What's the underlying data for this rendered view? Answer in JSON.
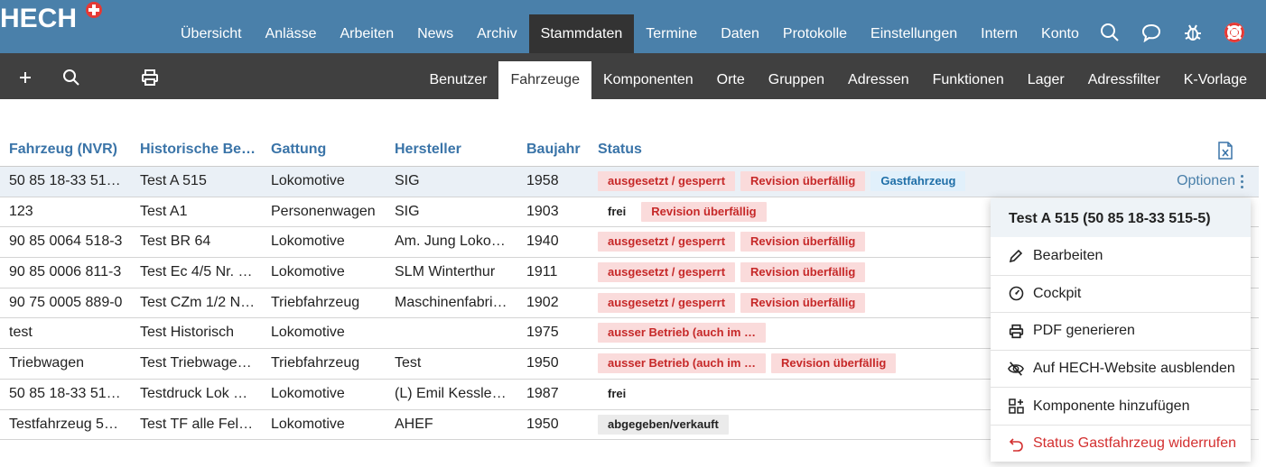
{
  "brand": {
    "name": "HECH"
  },
  "main_nav": [
    {
      "label": "Übersicht"
    },
    {
      "label": "Anlässe"
    },
    {
      "label": "Arbeiten"
    },
    {
      "label": "News"
    },
    {
      "label": "Archiv"
    },
    {
      "label": "Stammdaten",
      "active": true
    },
    {
      "label": "Termine"
    },
    {
      "label": "Daten"
    },
    {
      "label": "Protokolle"
    },
    {
      "label": "Einstellungen"
    },
    {
      "label": "Intern"
    },
    {
      "label": "Konto"
    }
  ],
  "top_icons": [
    "search-icon",
    "chat-bubble-icon",
    "bug-icon",
    "lifebuoy-icon"
  ],
  "toolbar_icons": [
    "plus-icon",
    "search-icon",
    "print-icon"
  ],
  "sub_nav": [
    {
      "label": "Benutzer"
    },
    {
      "label": "Fahrzeuge",
      "active": true
    },
    {
      "label": "Komponenten"
    },
    {
      "label": "Orte"
    },
    {
      "label": "Gruppen"
    },
    {
      "label": "Adressen"
    },
    {
      "label": "Funktionen"
    },
    {
      "label": "Lager"
    },
    {
      "label": "Adressfilter"
    },
    {
      "label": "K-Vorlage"
    }
  ],
  "table": {
    "columns": [
      "Fahrzeug (NVR)",
      "Historische Be…",
      "Gattung",
      "Hersteller",
      "Baujahr",
      "Status"
    ],
    "export_icon": "excel-export-icon",
    "options_label": "Optionen",
    "rows": [
      {
        "nvr": "50 85 18-33 51…",
        "hist": "Test A 515",
        "gattung": "Lokomotive",
        "hersteller": "SIG",
        "baujahr": "1958",
        "status": [
          {
            "text": "ausgesetzt / gesperrt",
            "style": "red"
          },
          {
            "text": "Revision überfällig",
            "style": "red"
          },
          {
            "text": "Gastfahrzeug",
            "style": "blue"
          }
        ],
        "selected": true
      },
      {
        "nvr": "123",
        "hist": "Test A1",
        "gattung": "Personenwagen",
        "hersteller": "SIG",
        "baujahr": "1903",
        "status": [
          {
            "text": "frei",
            "style": "plain"
          },
          {
            "text": "Revision überfällig",
            "style": "red"
          }
        ]
      },
      {
        "nvr": "90 85 0064 518-3",
        "hist": "Test BR 64",
        "gattung": "Lokomotive",
        "hersteller": "Am. Jung Loko…",
        "baujahr": "1940",
        "status": [
          {
            "text": "ausgesetzt / gesperrt",
            "style": "red"
          },
          {
            "text": "Revision überfällig",
            "style": "red"
          }
        ]
      },
      {
        "nvr": "90 85 0006 811-3",
        "hist": "Test Ec 4/5 Nr. …",
        "gattung": "Lokomotive",
        "hersteller": "SLM Winterthur",
        "baujahr": "1911",
        "status": [
          {
            "text": "ausgesetzt / gesperrt",
            "style": "red"
          },
          {
            "text": "Revision überfällig",
            "style": "red"
          }
        ]
      },
      {
        "nvr": "90 75 0005 889-0",
        "hist": "Test CZm 1/2 N…",
        "gattung": "Triebfahrzeug",
        "hersteller": "Maschinenfabri…",
        "baujahr": "1902",
        "status": [
          {
            "text": "ausgesetzt / gesperrt",
            "style": "red"
          },
          {
            "text": "Revision überfällig",
            "style": "red"
          }
        ]
      },
      {
        "nvr": "test",
        "hist": "Test Historisch",
        "gattung": "Lokomotive",
        "hersteller": "",
        "baujahr": "1975",
        "status": [
          {
            "text": "ausser Betrieb (auch im …",
            "style": "red"
          }
        ]
      },
      {
        "nvr": "Triebwagen",
        "hist": "Test Triebwage…",
        "gattung": "Triebfahrzeug",
        "hersteller": "Test",
        "baujahr": "1950",
        "status": [
          {
            "text": "ausser Betrieb (auch im …",
            "style": "red"
          },
          {
            "text": "Revision überfällig",
            "style": "red"
          }
        ]
      },
      {
        "nvr": "50 85 18-33 51…",
        "hist": "Testdruck Lok 5…",
        "gattung": "Lokomotive",
        "hersteller": "(L) Emil Kessler…",
        "baujahr": "1987",
        "status": [
          {
            "text": "frei",
            "style": "plain"
          }
        ]
      },
      {
        "nvr": "Testfahrzeug 5…",
        "hist": "Test TF alle Fel…",
        "gattung": "Lokomotive",
        "hersteller": "AHEF",
        "baujahr": "1950",
        "status": [
          {
            "text": "abgegeben/verkauft",
            "style": "grey"
          }
        ]
      }
    ]
  },
  "menu": {
    "title": "Test A 515 (50 85 18-33 515-5)",
    "items": [
      {
        "label": "Bearbeiten",
        "icon": "pencil-icon"
      },
      {
        "label": "Cockpit",
        "icon": "gauge-icon"
      },
      {
        "label": "PDF generieren",
        "icon": "print-icon"
      },
      {
        "label": "Auf HECH-Website ausblenden",
        "icon": "eye-off-icon"
      },
      {
        "label": "Komponente hinzufügen",
        "icon": "add-component-icon"
      },
      {
        "label": "Status Gastfahrzeug widerrufen",
        "icon": "undo-icon",
        "danger": true
      }
    ]
  },
  "colors": {
    "header": "#4a80aa",
    "subbar": "#404040",
    "link": "#3a74a8",
    "danger": "#d32f2f"
  }
}
